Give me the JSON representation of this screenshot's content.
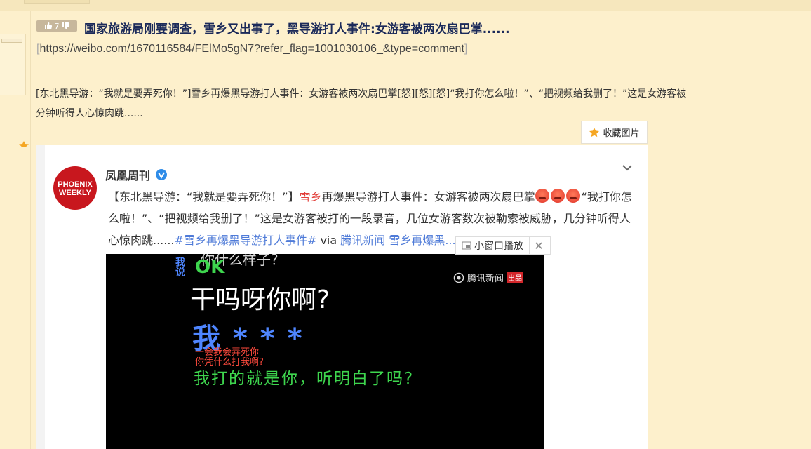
{
  "post": {
    "vote_count": "7",
    "title": "国家旅游局刚要调查，雪乡又出事了，黑导游打人事件:女游客被两次扇巴掌......",
    "link_open": "[",
    "link_url": "https://weibo.com/1670116584/FElMo5gN7?refer_flag=1001030106_&type=comment",
    "link_close": "]",
    "body_line1": "[东北黑导游：“我就是要弄死你！”]雪乡再爆黑导游打人事件：女游客被两次扇巴掌[怒][怒][怒]“我打你怎么啦！”、“把视频给我删了！”这是女游客被",
    "body_line2": "分钟听得人心惊肉跳......",
    "favorite_label": "收藏图片"
  },
  "weibo_card": {
    "avatar_text": "PHOENIX WEEKLY",
    "author": "凤凰周刊",
    "text_part1": "【东北黑导游：“我就是要弄死你！”】",
    "text_hl": "雪乡",
    "text_part2": "再爆黑导游打人事件：女游客被两次扇巴掌",
    "text_part3": "“我打你怎么啦！”、“把视频给我删了！”这是女游客被打的一段录音，几位女游客数次被勒索被威胁，几分钟听得人心惊肉跳......",
    "hashtag": "#雪乡再爆黑导游打人事件#",
    "via": " via ",
    "via_link": "腾讯新闻 雪乡再爆黑...",
    "float_label": "小窗口播放",
    "float_close": "✕"
  },
  "video": {
    "top_text": "你什么样子？",
    "side_text": "我说",
    "ok": "OK",
    "logo_text": "腾讯新闻",
    "logo_badge": "出品",
    "line1": "干吗呀你啊?",
    "line2": "我 * * *",
    "line3a": "一会我会弄死你",
    "line3b": "你凭什么打我啊?",
    "line4": "我打的就是你，听明白了吗?"
  },
  "colors": {
    "page_bg": "#fdf0cc",
    "title": "#1b2a5a",
    "hashtag": "#4f7bd8",
    "highlight": "#e2403b",
    "avatar": "#c8171e"
  }
}
